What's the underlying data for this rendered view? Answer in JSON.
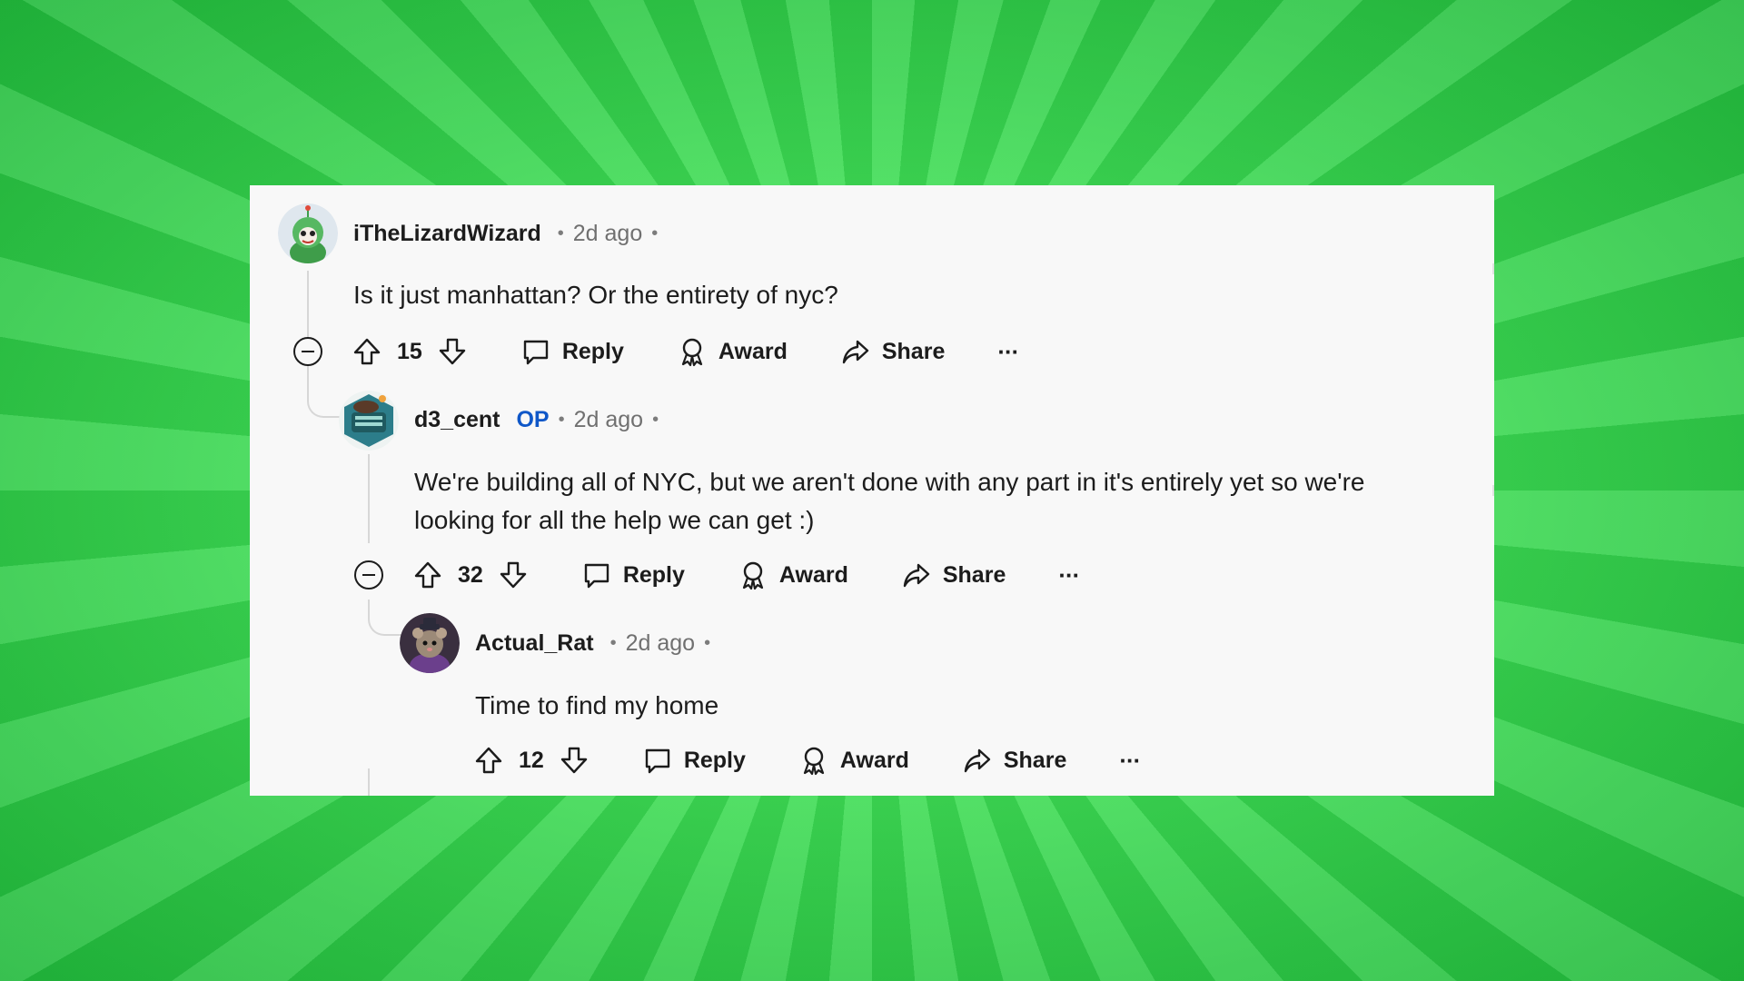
{
  "comments": [
    {
      "username": "iTheLizardWizard",
      "time": "2d ago",
      "body": "Is it just manhattan? Or the entirety of nyc?",
      "score": "15"
    },
    {
      "username": "d3_cent",
      "op_tag": "OP",
      "time": "2d ago",
      "body": "We're building all of NYC, but we aren't done with any part in it's entirely yet so we're looking for all the help we can get :)",
      "score": "32"
    },
    {
      "username": "Actual_Rat",
      "time": "2d ago",
      "body": "Time to find my home",
      "score": "12"
    }
  ],
  "labels": {
    "dot": "•",
    "reply": "Reply",
    "award": "Award",
    "share": "Share",
    "more": "···"
  },
  "colors": {
    "background_green": "#3fdc55",
    "card": "#f8f8f8",
    "op": "#0f57c8",
    "thread_line": "#d7d7d7"
  },
  "icons": [
    "upvote-icon",
    "downvote-icon",
    "comment-icon",
    "award-icon",
    "share-icon",
    "collapse-icon",
    "more-icon"
  ]
}
